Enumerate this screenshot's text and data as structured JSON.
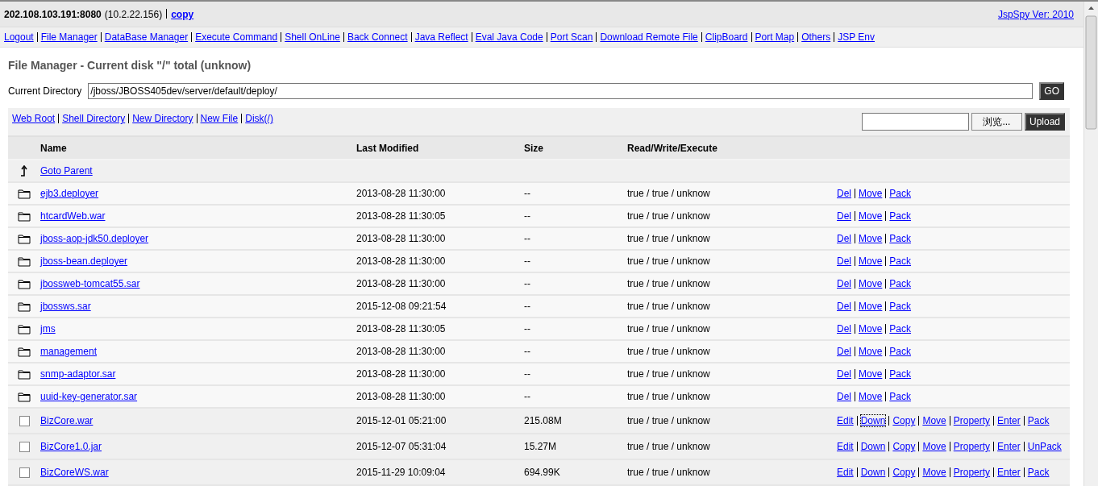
{
  "header": {
    "host": "202.108.103.191:8080",
    "ip": "(10.2.22.156)",
    "copy_link": "copy",
    "version_link": "JspSpy Ver: 2010"
  },
  "nav": [
    "Logout",
    "File Manager",
    "DataBase Manager",
    "Execute Command",
    "Shell OnLine",
    "Back Connect",
    "Java Reflect",
    "Eval Java Code",
    "Port Scan",
    "Download Remote File",
    "ClipBoard",
    "Port Map",
    "Others",
    "JSP Env"
  ],
  "title": "File Manager - Current disk \"/\" total (unknow)",
  "directory": {
    "label": "Current Directory",
    "value": "/jboss/JBOSS405dev/server/default/deploy/",
    "button": "GO"
  },
  "toolbar": {
    "links": [
      "Web Root",
      "Shell Directory",
      "New Directory",
      "New File",
      "Disk(/)"
    ],
    "browse_button": "浏览...",
    "upload_button": "Upload"
  },
  "table": {
    "columns": [
      "Name",
      "Last Modified",
      "Size",
      "Read/Write/Execute"
    ],
    "rows": [
      {
        "kind": "parent",
        "name": "Goto Parent"
      },
      {
        "kind": "dir",
        "name": "ejb3.deployer",
        "modified": "2013-08-28 11:30:00",
        "size": "--",
        "rwx": "true / true / unknow",
        "actions": [
          {
            "label": "Del",
            "focused": false
          },
          {
            "label": "Move",
            "focused": false
          },
          {
            "label": "Pack",
            "focused": false
          }
        ]
      },
      {
        "kind": "dir",
        "name": "htcardWeb.war",
        "modified": "2013-08-28 11:30:05",
        "size": "--",
        "rwx": "true / true / unknow",
        "actions": [
          {
            "label": "Del",
            "focused": false
          },
          {
            "label": "Move",
            "focused": false
          },
          {
            "label": "Pack",
            "focused": false
          }
        ]
      },
      {
        "kind": "dir",
        "name": "jboss-aop-jdk50.deployer",
        "modified": "2013-08-28 11:30:00",
        "size": "--",
        "rwx": "true / true / unknow",
        "actions": [
          {
            "label": "Del",
            "focused": false
          },
          {
            "label": "Move",
            "focused": false
          },
          {
            "label": "Pack",
            "focused": false
          }
        ]
      },
      {
        "kind": "dir",
        "name": "jboss-bean.deployer",
        "modified": "2013-08-28 11:30:00",
        "size": "--",
        "rwx": "true / true / unknow",
        "actions": [
          {
            "label": "Del",
            "focused": false
          },
          {
            "label": "Move",
            "focused": false
          },
          {
            "label": "Pack",
            "focused": false
          }
        ]
      },
      {
        "kind": "dir",
        "name": "jbossweb-tomcat55.sar",
        "modified": "2013-08-28 11:30:00",
        "size": "--",
        "rwx": "true / true / unknow",
        "actions": [
          {
            "label": "Del",
            "focused": false
          },
          {
            "label": "Move",
            "focused": false
          },
          {
            "label": "Pack",
            "focused": false
          }
        ]
      },
      {
        "kind": "dir",
        "name": "jbossws.sar",
        "modified": "2015-12-08 09:21:54",
        "size": "--",
        "rwx": "true / true / unknow",
        "actions": [
          {
            "label": "Del",
            "focused": false
          },
          {
            "label": "Move",
            "focused": false
          },
          {
            "label": "Pack",
            "focused": false
          }
        ]
      },
      {
        "kind": "dir",
        "name": "jms",
        "modified": "2013-08-28 11:30:05",
        "size": "--",
        "rwx": "true / true / unknow",
        "actions": [
          {
            "label": "Del",
            "focused": false
          },
          {
            "label": "Move",
            "focused": false
          },
          {
            "label": "Pack",
            "focused": false
          }
        ]
      },
      {
        "kind": "dir",
        "name": "management",
        "modified": "2013-08-28 11:30:00",
        "size": "--",
        "rwx": "true / true / unknow",
        "actions": [
          {
            "label": "Del",
            "focused": false
          },
          {
            "label": "Move",
            "focused": false
          },
          {
            "label": "Pack",
            "focused": false
          }
        ]
      },
      {
        "kind": "dir",
        "name": "snmp-adaptor.sar",
        "modified": "2013-08-28 11:30:00",
        "size": "--",
        "rwx": "true / true / unknow",
        "actions": [
          {
            "label": "Del",
            "focused": false
          },
          {
            "label": "Move",
            "focused": false
          },
          {
            "label": "Pack",
            "focused": false
          }
        ]
      },
      {
        "kind": "dir",
        "name": "uuid-key-generator.sar",
        "modified": "2013-08-28 11:30:00",
        "size": "--",
        "rwx": "true / true / unknow",
        "actions": [
          {
            "label": "Del",
            "focused": false
          },
          {
            "label": "Move",
            "focused": false
          },
          {
            "label": "Pack",
            "focused": false
          }
        ]
      },
      {
        "kind": "file",
        "checked": false,
        "name": "BizCore.war",
        "modified": "2015-12-01 05:21:00",
        "size": "215.08M",
        "rwx": "true / true / unknow",
        "actions": [
          {
            "label": "Edit",
            "focused": false
          },
          {
            "label": "Down",
            "focused": true
          },
          {
            "label": "Copy",
            "focused": false
          },
          {
            "label": "Move",
            "focused": false
          },
          {
            "label": "Property",
            "focused": false
          },
          {
            "label": "Enter",
            "focused": false
          },
          {
            "label": "Pack",
            "focused": false
          }
        ]
      },
      {
        "kind": "file",
        "checked": false,
        "name": "BizCore1.0.jar",
        "modified": "2015-12-07 05:31:04",
        "size": "15.27M",
        "rwx": "true / true / unknow",
        "actions": [
          {
            "label": "Edit",
            "focused": false
          },
          {
            "label": "Down",
            "focused": false
          },
          {
            "label": "Copy",
            "focused": false
          },
          {
            "label": "Move",
            "focused": false
          },
          {
            "label": "Property",
            "focused": false
          },
          {
            "label": "Enter",
            "focused": false
          },
          {
            "label": "UnPack",
            "focused": false
          }
        ]
      },
      {
        "kind": "file",
        "checked": false,
        "name": "BizCoreWS.war",
        "modified": "2015-11-29 10:09:04",
        "size": "694.99K",
        "rwx": "true / true / unknow",
        "actions": [
          {
            "label": "Edit",
            "focused": false
          },
          {
            "label": "Down",
            "focused": false
          },
          {
            "label": "Copy",
            "focused": false
          },
          {
            "label": "Move",
            "focused": false
          },
          {
            "label": "Property",
            "focused": false
          },
          {
            "label": "Enter",
            "focused": false
          },
          {
            "label": "Pack",
            "focused": false
          }
        ]
      }
    ]
  }
}
